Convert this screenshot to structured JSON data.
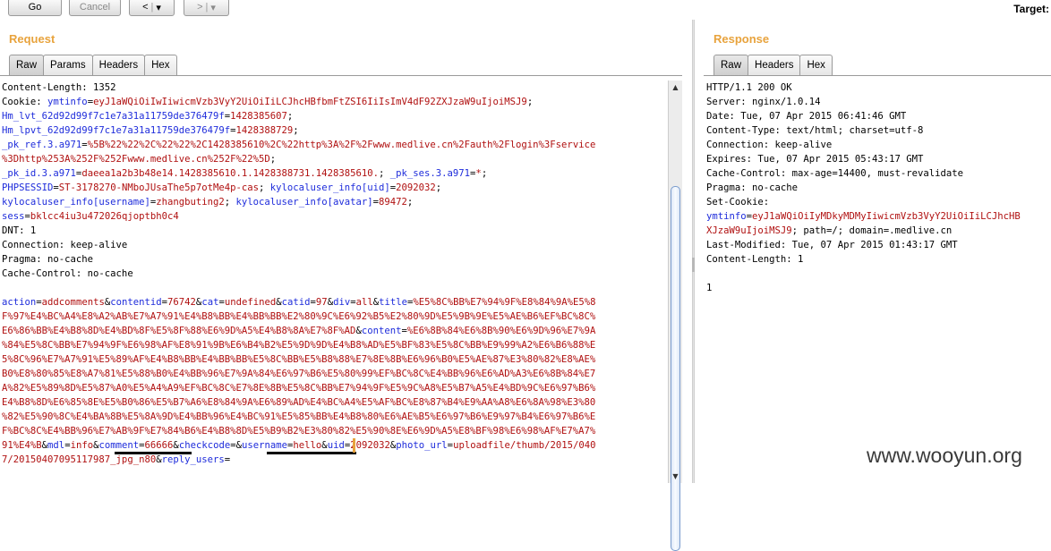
{
  "toolbar": {
    "go": "Go",
    "cancel": "Cancel",
    "back_arrow": "<",
    "forward_arrow": ">",
    "dropdown": "▾",
    "target_label": "Target:"
  },
  "request": {
    "title": "Request",
    "tabs": [
      "Raw",
      "Params",
      "Headers",
      "Hex"
    ],
    "active_tab": "Raw"
  },
  "response": {
    "title": "Response",
    "tabs": [
      "Raw",
      "Headers",
      "Hex"
    ],
    "active_tab": "Raw"
  },
  "request_lines": [
    [
      [
        "",
        "Content-Length: 1352"
      ]
    ],
    [
      [
        "",
        "Cookie: "
      ],
      [
        "blue",
        "ymtinfo"
      ],
      [
        "",
        "="
      ],
      [
        "red",
        "eyJ1aWQiOiIwIiwicmVzb3VyY2UiOiIiLCJhcHBfbmFtZSI6IiIsImV4dF92ZXJzaW9uIjoiMSJ9"
      ],
      [
        "",
        ";"
      ]
    ],
    [
      [
        "blue",
        "Hm_lvt_62d92d99f7c1e7a31a11759de376479f"
      ],
      [
        "",
        "="
      ],
      [
        "red",
        "1428385607"
      ],
      [
        "",
        ";"
      ]
    ],
    [
      [
        "blue",
        "Hm_lpvt_62d92d99f7c1e7a31a11759de376479f"
      ],
      [
        "",
        "="
      ],
      [
        "red",
        "1428388729"
      ],
      [
        "",
        ";"
      ]
    ],
    [
      [
        "blue",
        "_pk_ref.3.a971"
      ],
      [
        "",
        "="
      ],
      [
        "red",
        "%5B%22%22%2C%22%22%2C1428385610%2C%22http%3A%2F%2Fwww.medlive.cn%2Fauth%2Flogin%3Fservice"
      ]
    ],
    [
      [
        "red",
        "%3Dhttp%253A%252F%252Fwww.medlive.cn%252F%22%5D"
      ],
      [
        "",
        ";"
      ]
    ],
    [
      [
        "blue",
        "_pk_id.3.a971"
      ],
      [
        "",
        "="
      ],
      [
        "red",
        "daeea1a2b3b48e14.1428385610.1.1428388731.1428385610."
      ],
      [
        "",
        "; "
      ],
      [
        "blue",
        "_pk_ses.3.a971"
      ],
      [
        "",
        "="
      ],
      [
        "red",
        "*"
      ],
      [
        "",
        ";"
      ]
    ],
    [
      [
        "blue",
        "PHPSESSID"
      ],
      [
        "",
        "="
      ],
      [
        "red",
        "ST-3178270-NMboJUsaThe5p7otMe4p-cas"
      ],
      [
        "",
        "; "
      ],
      [
        "blue",
        "kylocaluser_info[uid]"
      ],
      [
        "",
        "="
      ],
      [
        "red",
        "2092032"
      ],
      [
        "",
        ";"
      ]
    ],
    [
      [
        "blue",
        "kylocaluser_info[username]"
      ],
      [
        "",
        "="
      ],
      [
        "red",
        "zhangbuting2"
      ],
      [
        "",
        "; "
      ],
      [
        "blue",
        "kylocaluser_info[avatar]"
      ],
      [
        "",
        "="
      ],
      [
        "red",
        "89472"
      ],
      [
        "",
        ";"
      ]
    ],
    [
      [
        "blue",
        "sess"
      ],
      [
        "",
        "="
      ],
      [
        "red",
        "bklcc4iu3u472026qjoptbh0c4"
      ]
    ],
    [
      [
        "",
        "DNT: 1"
      ]
    ],
    [
      [
        "",
        "Connection: keep-alive"
      ]
    ],
    [
      [
        "",
        "Pragma: no-cache"
      ]
    ],
    [
      [
        "",
        "Cache-Control: no-cache"
      ]
    ],
    [
      [
        "",
        ""
      ]
    ],
    [
      [
        "blue",
        "action"
      ],
      [
        "",
        "="
      ],
      [
        "red",
        "addcomments"
      ],
      [
        "",
        "&"
      ],
      [
        "blue",
        "contentid"
      ],
      [
        "",
        "="
      ],
      [
        "red",
        "76742"
      ],
      [
        "",
        "&"
      ],
      [
        "blue",
        "cat"
      ],
      [
        "",
        "="
      ],
      [
        "red",
        "undefined"
      ],
      [
        "",
        "&"
      ],
      [
        "blue",
        "catid"
      ],
      [
        "",
        "="
      ],
      [
        "red",
        "97"
      ],
      [
        "",
        "&"
      ],
      [
        "blue",
        "div"
      ],
      [
        "",
        "="
      ],
      [
        "red",
        "all"
      ],
      [
        "",
        "&"
      ],
      [
        "blue",
        "title"
      ],
      [
        "",
        "="
      ],
      [
        "red",
        "%E5%8C%BB%E7%94%9F%E8%84%9A%E5%8"
      ]
    ],
    [
      [
        "red",
        "F%97%E4%BC%A4%E8%A2%AB%E7%A7%91%E4%B8%BB%E4%BB%BB%E2%80%9C%E6%92%B5%E2%80%9D%E5%9B%9E%E5%AE%B6%EF%BC%8C%"
      ]
    ],
    [
      [
        "red",
        "E6%86%BB%E4%B8%8D%E4%BD%8F%E5%8F%88%E6%9D%A5%E4%B8%8A%E7%8F%AD"
      ],
      [
        "",
        "&"
      ],
      [
        "blue",
        "content"
      ],
      [
        "",
        "="
      ],
      [
        "red",
        "%E6%8B%84%E6%8B%90%E6%9D%96%E7%9A"
      ]
    ],
    [
      [
        "red",
        "%84%E5%8C%BB%E7%94%9F%E6%98%AF%E8%91%9B%E6%B4%B2%E5%9D%9D%E4%B8%AD%E5%BF%83%E5%8C%BB%E9%99%A2%E6%B6%88%E"
      ]
    ],
    [
      [
        "red",
        "5%8C%96%E7%A7%91%E5%89%AF%E4%B8%BB%E4%BB%BB%E5%8C%BB%E5%B8%88%E7%8E%8B%E6%96%B0%E5%AE%87%E3%80%82%E8%AE%"
      ]
    ],
    [
      [
        "red",
        "B0%E8%80%85%E8%A7%81%E5%88%B0%E4%BB%96%E7%9A%84%E6%97%B6%E5%80%99%EF%BC%8C%E4%BB%96%E6%AD%A3%E6%8B%84%E7"
      ]
    ],
    [
      [
        "red",
        "A%82%E5%89%8D%E5%87%A0%E5%A4%A9%EF%BC%8C%E7%8E%8B%E5%8C%BB%E7%94%9F%E5%9C%A8%E5%B7%A5%E4%BD%9C%E6%97%B6%"
      ]
    ],
    [
      [
        "red",
        "E4%B8%8D%E6%85%8E%E5%B0%86%E5%B7%A6%E8%84%9A%E6%89%AD%E4%BC%A4%E5%AF%BC%E8%87%B4%E9%AA%A8%E6%8A%98%E3%80"
      ]
    ],
    [
      [
        "red",
        "%82%E5%90%8C%E4%BA%8B%E5%8A%9D%E4%BB%96%E4%BC%91%E5%85%BB%E4%B8%80%E6%AE%B5%E6%97%B6%E9%97%B4%E6%97%B6%E"
      ]
    ],
    [
      [
        "red",
        "F%BC%8C%E4%BB%96%E7%AB%9F%E7%84%B6%E4%B8%8D%E5%B9%B2%E3%80%82%E5%90%8E%E6%9D%A5%E8%BF%98%E6%98%AF%E7%A7%"
      ]
    ],
    [
      [
        "red",
        "91%E4%B"
      ],
      [
        "",
        "&"
      ],
      [
        "blue",
        "mdl"
      ],
      [
        "",
        "="
      ],
      [
        "red",
        "info"
      ],
      [
        "",
        "&"
      ],
      [
        "blue",
        "comment"
      ],
      [
        "",
        "="
      ],
      [
        "red",
        "66666"
      ],
      [
        "",
        "&"
      ],
      [
        "blue",
        "checkcode"
      ],
      [
        "",
        "=&"
      ],
      [
        "blue",
        "username"
      ],
      [
        "",
        "="
      ],
      [
        "red",
        "hello"
      ],
      [
        "",
        "&"
      ],
      [
        "blue",
        "uid"
      ],
      [
        "",
        "="
      ],
      [
        "red",
        "2092032"
      ],
      [
        "",
        "&"
      ],
      [
        "blue",
        "photo_url"
      ],
      [
        "",
        "="
      ],
      [
        "red",
        "uploadfile/thumb/2015/040"
      ]
    ],
    [
      [
        "red",
        "7/20150407095117987_jpg_n80"
      ],
      [
        "",
        "&"
      ],
      [
        "blue",
        "reply_users"
      ],
      [
        "",
        "="
      ]
    ]
  ],
  "response_lines": [
    [
      [
        "",
        "HTTP/1.1 200 OK"
      ]
    ],
    [
      [
        "",
        "Server: nginx/1.0.14"
      ]
    ],
    [
      [
        "",
        "Date: Tue, 07 Apr 2015 06:41:46 GMT"
      ]
    ],
    [
      [
        "",
        "Content-Type: text/html; charset=utf-8"
      ]
    ],
    [
      [
        "",
        "Connection: keep-alive"
      ]
    ],
    [
      [
        "",
        "Expires: Tue, 07 Apr 2015 05:43:17 GMT"
      ]
    ],
    [
      [
        "",
        "Cache-Control: max-age=14400, must-revalidate"
      ]
    ],
    [
      [
        "",
        "Pragma: no-cache"
      ]
    ],
    [
      [
        "",
        "Set-Cookie:"
      ]
    ],
    [
      [
        "blue",
        "ymtinfo"
      ],
      [
        "",
        "="
      ],
      [
        "red",
        "eyJ1aWQiOiIyMDkyMDMyIiwicmVzb3VyY2UiOiIiLCJhcHB"
      ]
    ],
    [
      [
        "red",
        "XJzaW9uIjoiMSJ9"
      ],
      [
        "",
        "; path=/; domain=.medlive.cn"
      ]
    ],
    [
      [
        "",
        "Last-Modified: Tue, 07 Apr 2015 01:43:17 GMT"
      ]
    ],
    [
      [
        "",
        "Content-Length: 1"
      ]
    ],
    [
      [
        "",
        ""
      ]
    ],
    [
      [
        "",
        "1"
      ]
    ]
  ],
  "watermark": "www.wooyun.org",
  "scroll_up_glyph": "▲",
  "scroll_down_glyph": "▼"
}
